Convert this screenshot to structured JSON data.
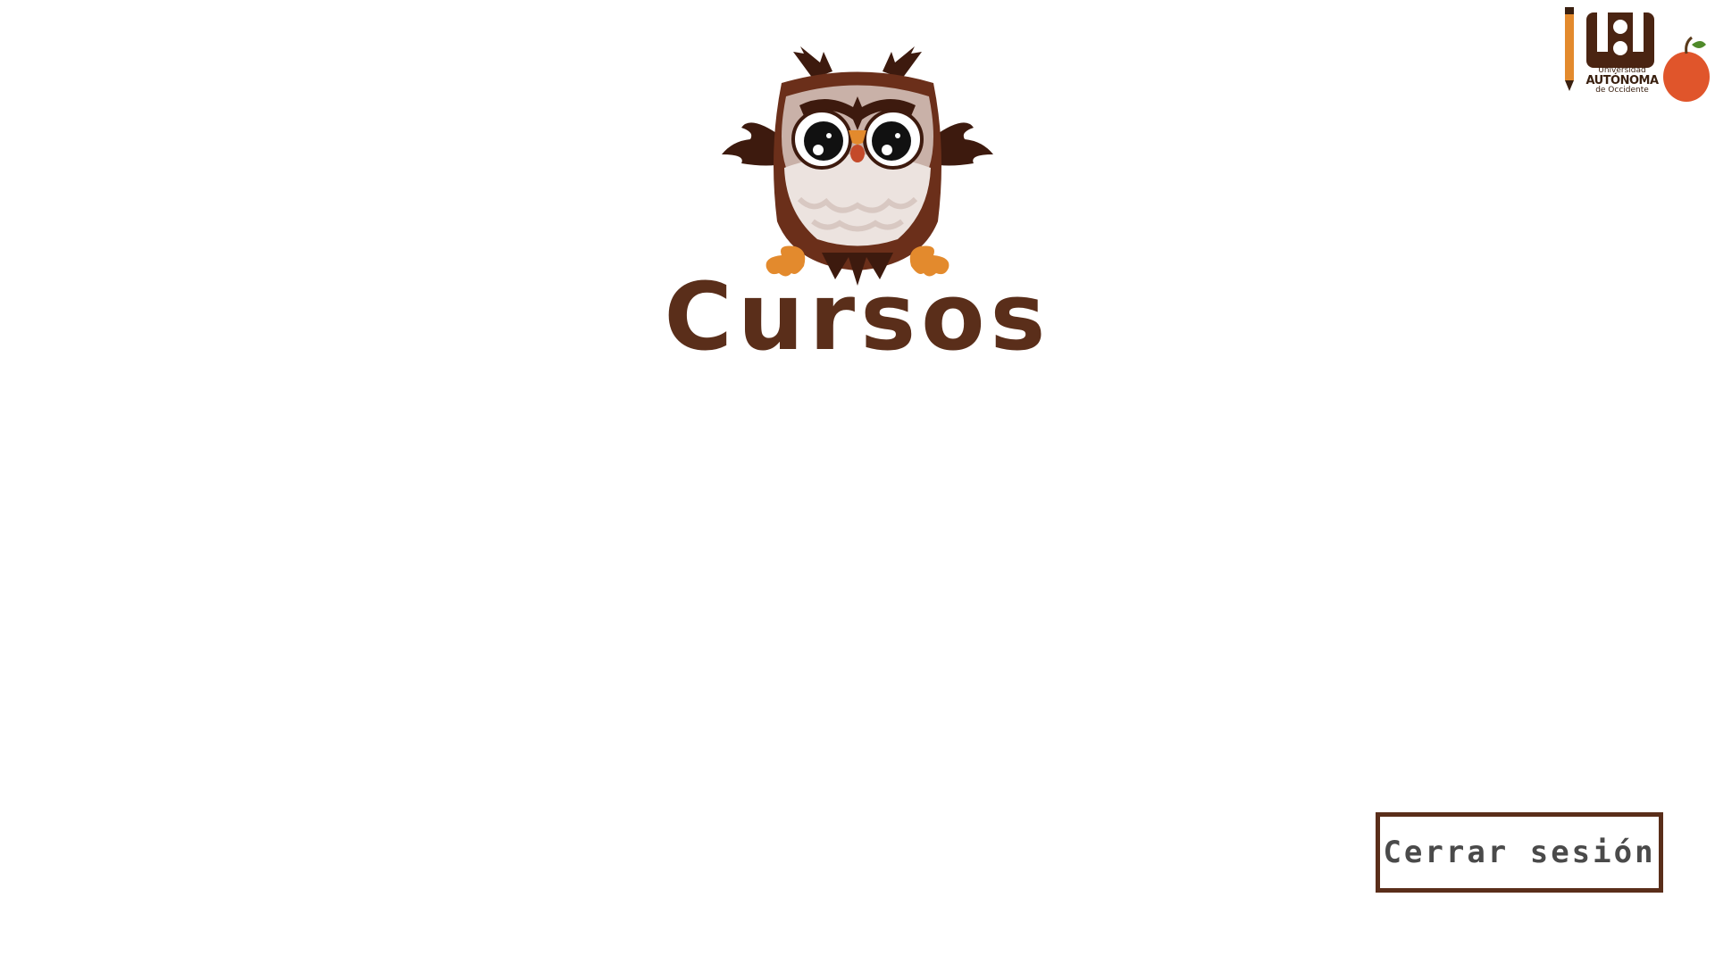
{
  "header": {
    "title": "Cursos",
    "mascot_icon": "owl-icon"
  },
  "logo": {
    "icon": "university-logo-icon",
    "line1": "Universidad",
    "line2": "AUTÓNOMA",
    "line3": "de Occidente"
  },
  "actions": {
    "logout_label": "Cerrar sesión"
  },
  "colors": {
    "brand_brown": "#5a2e1a",
    "owl_dark": "#3d1a0e",
    "owl_light": "#ece3df",
    "accent_orange": "#e38a2d",
    "background": "#ffffff"
  }
}
